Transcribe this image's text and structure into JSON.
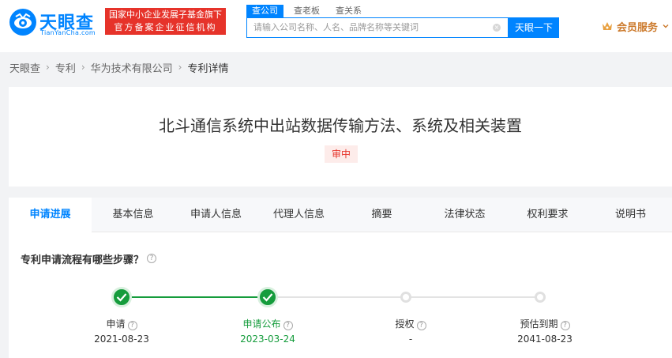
{
  "header": {
    "logo_cn": "天眼查",
    "logo_en": "TianYanCha.com",
    "gov_badge_line1": "国家中小企业发展子基金旗下",
    "gov_badge_line2": "官方备案企业征信机构",
    "search_tabs": [
      "查公司",
      "查老板",
      "查关系"
    ],
    "search_placeholder": "请输入公司名称、人名、品牌名称等关键词",
    "search_button": "天眼一下",
    "member_label": "会员服务",
    "brand_color": "#0084ff"
  },
  "breadcrumb": [
    "天眼查",
    "专利",
    "华为技术有限公司",
    "专利详情"
  ],
  "patent": {
    "title": "北斗通信系统中出站数据传输方法、系统及相关装置",
    "status": "审中"
  },
  "tabs": [
    "申请进展",
    "基本信息",
    "申请人信息",
    "代理人信息",
    "摘要",
    "法律状态",
    "权利要求",
    "说明书"
  ],
  "progress": {
    "question": "专利申请流程有哪些步骤？",
    "steps": [
      {
        "label": "申请",
        "date": "2021-08-23",
        "done": true
      },
      {
        "label": "申请公布",
        "date": "2023-03-24",
        "done": true
      },
      {
        "label": "授权",
        "date": "-",
        "done": false
      },
      {
        "label": "预估到期",
        "date": "2041-08-23",
        "done": false
      }
    ],
    "done_color": "#159c3c"
  }
}
